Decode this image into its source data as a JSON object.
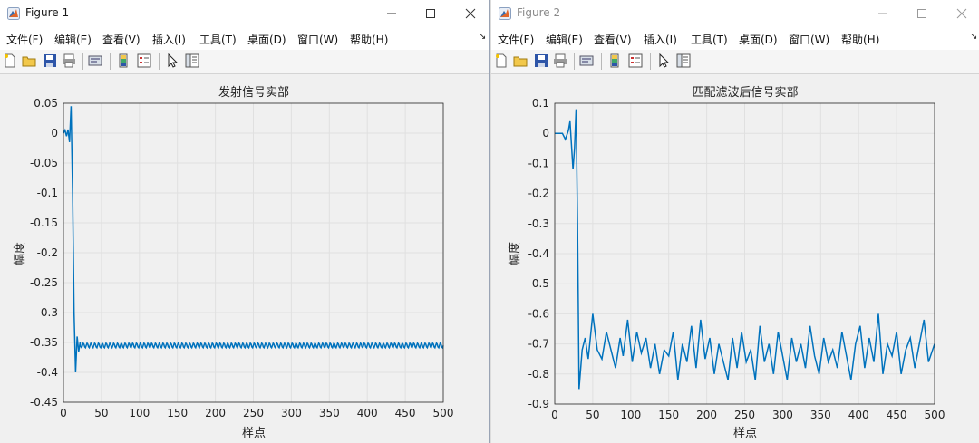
{
  "windows": [
    {
      "title": "Figure 1",
      "menu": [
        "文件(F)",
        "编辑(E)",
        "查看(V)",
        "插入(I)",
        "工具(T)",
        "桌面(D)",
        "窗口(W)",
        "帮助(H)"
      ],
      "toolbar_icons": [
        "new-figure-icon",
        "open-file-icon",
        "save-icon",
        "print-icon",
        "link-plot-icon",
        "colorbar-icon",
        "legend-icon",
        "pointer-icon",
        "property-editor-icon"
      ],
      "chart": {
        "title": "发射信号实部",
        "xlabel": "样点",
        "ylabel": "幅度",
        "xticks": [
          "0",
          "50",
          "100",
          "150",
          "200",
          "250",
          "300",
          "350",
          "400",
          "450",
          "500"
        ],
        "yticks": [
          "0.05",
          "0",
          "-0.05",
          "-0.1",
          "-0.15",
          "-0.2",
          "-0.25",
          "-0.3",
          "-0.35",
          "-0.4",
          "-0.45"
        ]
      }
    },
    {
      "title": "Figure 2",
      "menu": [
        "文件(F)",
        "编辑(E)",
        "查看(V)",
        "插入(I)",
        "工具(T)",
        "桌面(D)",
        "窗口(W)",
        "帮助(H)"
      ],
      "toolbar_icons": [
        "new-figure-icon",
        "open-file-icon",
        "save-icon",
        "print-icon",
        "link-plot-icon",
        "colorbar-icon",
        "legend-icon",
        "pointer-icon",
        "property-editor-icon"
      ],
      "chart": {
        "title": "匹配滤波后信号实部",
        "xlabel": "样点",
        "ylabel": "幅度",
        "xticks": [
          "0",
          "50",
          "100",
          "150",
          "200",
          "250",
          "300",
          "350",
          "400",
          "450",
          "500"
        ],
        "yticks": [
          "0.1",
          "0",
          "-0.1",
          "-0.2",
          "-0.3",
          "-0.4",
          "-0.5",
          "-0.6",
          "-0.7",
          "-0.8",
          "-0.9"
        ]
      }
    }
  ],
  "chart_data": [
    {
      "type": "line",
      "title": "发射信号实部",
      "xlabel": "样点",
      "ylabel": "幅度",
      "xlim": [
        0,
        500
      ],
      "ylim": [
        -0.45,
        0.05
      ],
      "grid": true,
      "color": "#0072bd",
      "x": [
        0,
        2,
        4,
        6,
        8,
        10,
        12,
        14,
        16,
        18,
        20,
        22,
        25,
        30,
        40,
        60,
        100,
        200,
        300,
        400,
        450,
        500
      ],
      "y": [
        0,
        0.005,
        -0.005,
        0.006,
        -0.015,
        0.045,
        -0.1,
        -0.3,
        -0.4,
        -0.34,
        -0.365,
        -0.35,
        -0.355,
        -0.352,
        -0.356,
        -0.353,
        -0.355,
        -0.354,
        -0.355,
        -0.354,
        -0.355,
        -0.355
      ],
      "ripple": {
        "from": 22,
        "to": 500,
        "center": -0.355,
        "amplitude": 0.004,
        "period": 5
      }
    },
    {
      "type": "line",
      "title": "匹配滤波后信号实部",
      "xlabel": "样点",
      "ylabel": "幅度",
      "xlim": [
        0,
        500
      ],
      "ylim": [
        -0.9,
        0.1
      ],
      "grid": true,
      "color": "#0072bd",
      "x": [
        0,
        10,
        14,
        18,
        20,
        24,
        26,
        28,
        30,
        32,
        36,
        40,
        44,
        50,
        56,
        62,
        68,
        74,
        80,
        86,
        90,
        96,
        102,
        108,
        114,
        120,
        126,
        132,
        138,
        144,
        150,
        156,
        162,
        168,
        174,
        180,
        186,
        192,
        198,
        204,
        210,
        216,
        222,
        228,
        234,
        240,
        246,
        252,
        258,
        264,
        270,
        276,
        282,
        288,
        294,
        300,
        306,
        312,
        318,
        324,
        330,
        336,
        342,
        348,
        354,
        360,
        366,
        372,
        378,
        384,
        390,
        396,
        402,
        408,
        414,
        420,
        426,
        432,
        438,
        444,
        450,
        456,
        462,
        468,
        474,
        480,
        486,
        492,
        500
      ],
      "y": [
        0,
        0,
        -0.02,
        0.01,
        0.04,
        -0.12,
        -0.05,
        0.08,
        -0.3,
        -0.85,
        -0.72,
        -0.68,
        -0.75,
        -0.6,
        -0.72,
        -0.75,
        -0.66,
        -0.72,
        -0.78,
        -0.68,
        -0.74,
        -0.62,
        -0.76,
        -0.66,
        -0.73,
        -0.68,
        -0.78,
        -0.7,
        -0.8,
        -0.72,
        -0.74,
        -0.66,
        -0.82,
        -0.7,
        -0.76,
        -0.64,
        -0.78,
        -0.62,
        -0.75,
        -0.68,
        -0.8,
        -0.7,
        -0.76,
        -0.82,
        -0.68,
        -0.78,
        -0.66,
        -0.76,
        -0.72,
        -0.82,
        -0.64,
        -0.76,
        -0.7,
        -0.8,
        -0.66,
        -0.74,
        -0.82,
        -0.68,
        -0.76,
        -0.7,
        -0.78,
        -0.64,
        -0.74,
        -0.8,
        -0.68,
        -0.76,
        -0.72,
        -0.78,
        -0.66,
        -0.74,
        -0.82,
        -0.7,
        -0.64,
        -0.78,
        -0.68,
        -0.76,
        -0.6,
        -0.8,
        -0.7,
        -0.74,
        -0.66,
        -0.8,
        -0.72,
        -0.68,
        -0.78,
        -0.7,
        -0.62,
        -0.76,
        -0.7
      ]
    }
  ]
}
